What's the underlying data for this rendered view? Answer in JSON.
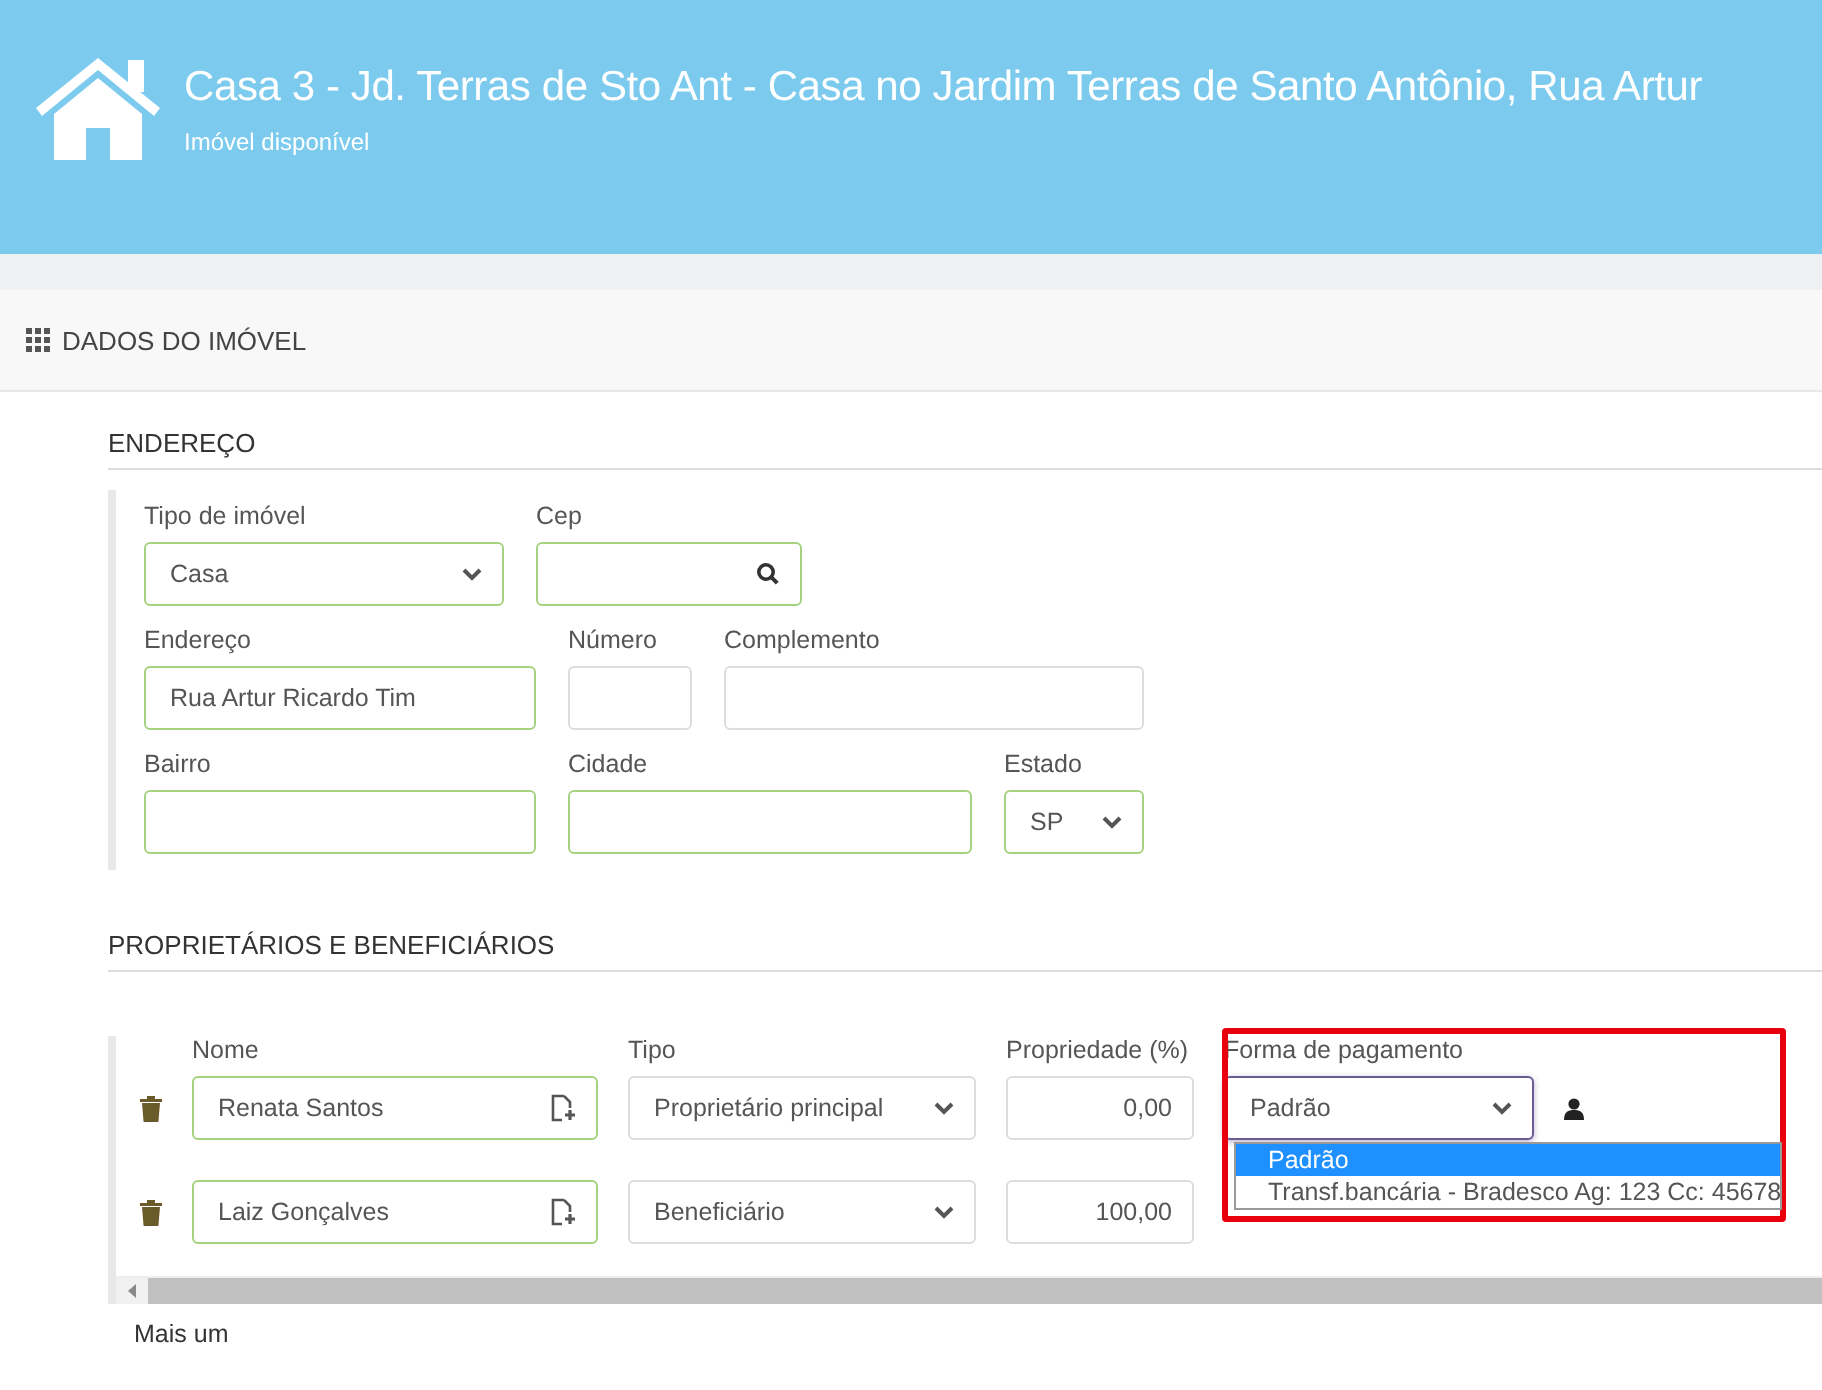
{
  "header": {
    "title": "Casa 3 - Jd. Terras de Sto Ant - Casa no Jardim Terras de Santo Antônio, Rua Artur",
    "subtitle": "Imóvel disponível"
  },
  "section": {
    "title": "DADOS DO IMÓVEL"
  },
  "endereco": {
    "heading": "ENDEREÇO",
    "rows": [
      [
        {
          "label": "Tipo de imóvel",
          "kind": "select",
          "value": "Casa",
          "valid": true
        },
        {
          "label": "Cep",
          "kind": "search",
          "valid": true
        }
      ],
      [
        {
          "label": "Endereço",
          "kind": "text",
          "value": "Rua Artur Ricardo Tim",
          "valid": true
        },
        {
          "label": "Número",
          "kind": "text",
          "valid": false
        },
        {
          "label": "Complemento",
          "kind": "text",
          "valid": false
        }
      ],
      [
        {
          "label": "Bairro",
          "kind": "text",
          "valid": true
        },
        {
          "label": "Cidade",
          "kind": "text",
          "valid": true
        },
        {
          "label": "Estado",
          "kind": "select",
          "value": "SP",
          "valid": true
        }
      ]
    ]
  },
  "owners": {
    "heading": "PROPRIETÁRIOS E BENEFICIÁRIOS",
    "columns": [
      "Nome",
      "Tipo",
      "Propriedade (%)",
      "Forma de pagamento"
    ],
    "rows": [
      {
        "name": "Renata Santos",
        "tipo": "Proprietário principal",
        "share": "0,00",
        "payment": "Padrão",
        "focused": true
      },
      {
        "name": "Laiz Gonçalves",
        "tipo": "Beneficiário",
        "share": "100,00"
      }
    ],
    "dropdown": [
      {
        "label": "Padrão",
        "selected": true
      },
      {
        "label": "Transf.bancária - Bradesco Ag: 123 Cc: 45678",
        "selected": false
      }
    ],
    "add_link": "Mais um"
  }
}
